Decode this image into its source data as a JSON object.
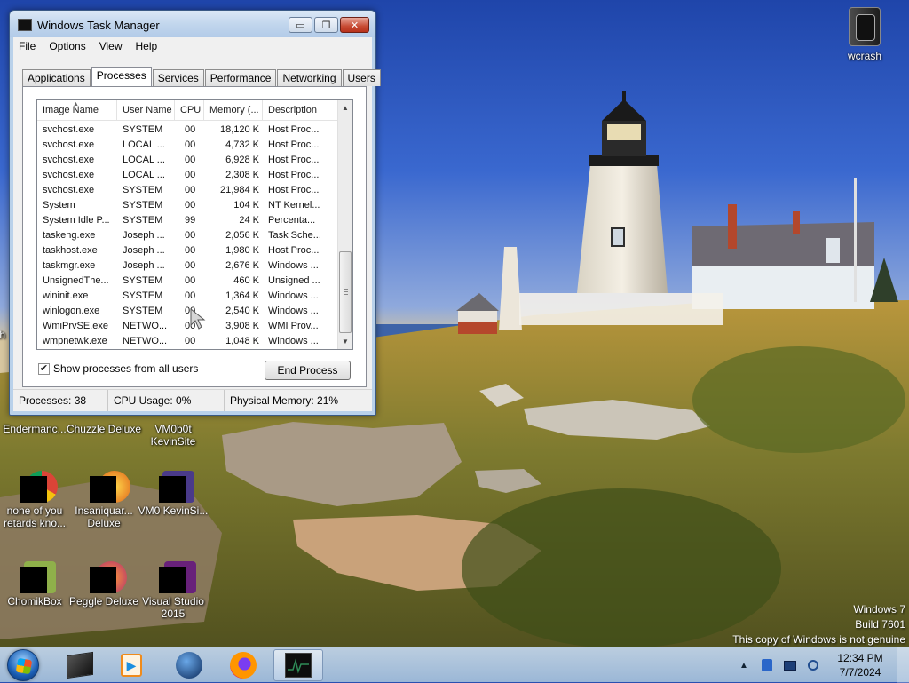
{
  "window": {
    "title": "Windows Task Manager",
    "minimize_glyph": "▭",
    "restore_glyph": "❐",
    "close_glyph": "✕",
    "menu": [
      "File",
      "Options",
      "View",
      "Help"
    ],
    "tabs": [
      "Applications",
      "Processes",
      "Services",
      "Performance",
      "Networking",
      "Users"
    ],
    "active_tab": "Processes"
  },
  "process_table": {
    "columns": [
      "Image Name",
      "User Name",
      "CPU",
      "Memory (...",
      "Description"
    ],
    "sort_column": "Image Name",
    "rows": [
      {
        "name": "svchost.exe",
        "user": "SYSTEM",
        "cpu": "00",
        "mem": "18,120 K",
        "desc": "Host Proc..."
      },
      {
        "name": "svchost.exe",
        "user": "LOCAL ...",
        "cpu": "00",
        "mem": "4,732 K",
        "desc": "Host Proc..."
      },
      {
        "name": "svchost.exe",
        "user": "LOCAL ...",
        "cpu": "00",
        "mem": "6,928 K",
        "desc": "Host Proc..."
      },
      {
        "name": "svchost.exe",
        "user": "LOCAL ...",
        "cpu": "00",
        "mem": "2,308 K",
        "desc": "Host Proc..."
      },
      {
        "name": "svchost.exe",
        "user": "SYSTEM",
        "cpu": "00",
        "mem": "21,984 K",
        "desc": "Host Proc..."
      },
      {
        "name": "System",
        "user": "SYSTEM",
        "cpu": "00",
        "mem": "104 K",
        "desc": "NT Kernel..."
      },
      {
        "name": "System Idle P...",
        "user": "SYSTEM",
        "cpu": "99",
        "mem": "24 K",
        "desc": "Percenta..."
      },
      {
        "name": "taskeng.exe",
        "user": "Joseph ...",
        "cpu": "00",
        "mem": "2,056 K",
        "desc": "Task Sche..."
      },
      {
        "name": "taskhost.exe",
        "user": "Joseph ...",
        "cpu": "00",
        "mem": "1,980 K",
        "desc": "Host Proc..."
      },
      {
        "name": "taskmgr.exe",
        "user": "Joseph ...",
        "cpu": "00",
        "mem": "2,676 K",
        "desc": "Windows ..."
      },
      {
        "name": "UnsignedThe...",
        "user": "SYSTEM",
        "cpu": "00",
        "mem": "460 K",
        "desc": "Unsigned ..."
      },
      {
        "name": "wininit.exe",
        "user": "SYSTEM",
        "cpu": "00",
        "mem": "1,364 K",
        "desc": "Windows ..."
      },
      {
        "name": "winlogon.exe",
        "user": "SYSTEM",
        "cpu": "00",
        "mem": "2,540 K",
        "desc": "Windows ..."
      },
      {
        "name": "WmiPrvSE.exe",
        "user": "NETWO...",
        "cpu": "00",
        "mem": "3,908 K",
        "desc": "WMI Prov..."
      },
      {
        "name": "wmpnetwk.exe",
        "user": "NETWO...",
        "cpu": "00",
        "mem": "1,048 K",
        "desc": "Windows ..."
      }
    ]
  },
  "show_all": {
    "label": "Show processes from all users",
    "checked": true,
    "check_glyph": "✔"
  },
  "end_process_label": "End Process",
  "status": {
    "processes": "Processes: 38",
    "cpu": "CPU Usage: 0%",
    "memory": "Physical Memory: 21%"
  },
  "desktop": {
    "top_right_icon": "wcrash",
    "icons": [
      {
        "label": "Endermanc...",
        "icon": "app-icon"
      },
      {
        "label": "Chuzzle Deluxe",
        "icon": "chuzzle-icon"
      },
      {
        "label": "VM0b0t KevinSite",
        "icon": "vm-icon"
      },
      {
        "label": "none of you retards kno...",
        "icon": "chrome-icon"
      },
      {
        "label": "Insaniquar... Deluxe",
        "icon": "insaniquarium-icon"
      },
      {
        "label": "VM0 KevinSi...",
        "icon": "vm-icon"
      },
      {
        "label": "ChomikBox",
        "icon": "chomikbox-icon"
      },
      {
        "label": "Peggle Deluxe",
        "icon": "peggle-icon"
      },
      {
        "label": "Visual Studio 2015",
        "icon": "visual-studio-icon"
      }
    ],
    "partial_label": "th"
  },
  "watermark": {
    "line1": "Windows 7",
    "line2": "Build 7601",
    "line3": "This copy of Windows is not genuine"
  },
  "taskbar": {
    "apps": [
      "task-manager-app",
      "media-player",
      "globe-app",
      "firefox",
      "task-manager"
    ],
    "clock_time": "12:34 PM",
    "clock_date": "7/7/2024",
    "tray_expand_glyph": "▲"
  },
  "colors": {
    "selection_blue": "#3399ff",
    "taskbar": "#a0bee2",
    "close_red": "#c74a33"
  }
}
